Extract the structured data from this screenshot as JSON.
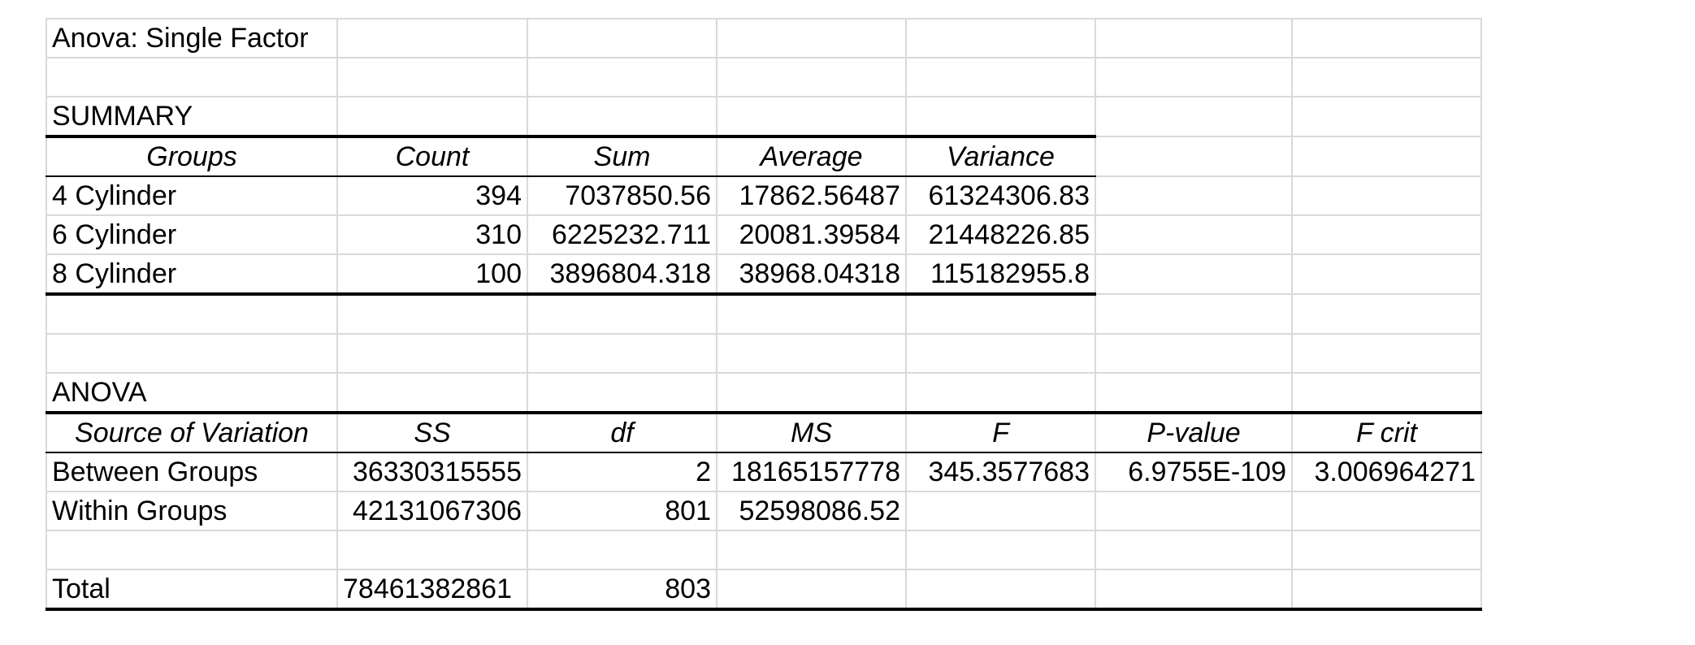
{
  "title": "Anova: Single Factor",
  "summary": {
    "label": "SUMMARY",
    "headers": [
      "Groups",
      "Count",
      "Sum",
      "Average",
      "Variance"
    ],
    "rows": [
      [
        "4 Cylinder",
        "394",
        "7037850.56",
        "17862.56487",
        "61324306.83"
      ],
      [
        "6 Cylinder",
        "310",
        "6225232.711",
        "20081.39584",
        "21448226.85"
      ],
      [
        "8 Cylinder",
        "100",
        "3896804.318",
        "38968.04318",
        "115182955.8"
      ]
    ]
  },
  "anova": {
    "label": "ANOVA",
    "headers": [
      "Source of Variation",
      "SS",
      "df",
      "MS",
      "F",
      "P-value",
      "F crit"
    ],
    "rows": [
      [
        "Between Groups",
        "36330315555",
        "2",
        "18165157778",
        "345.3577683",
        "6.9755E-109",
        "3.006964271"
      ],
      [
        "Within Groups",
        "42131067306",
        "801",
        "52598086.52",
        "",
        "",
        ""
      ]
    ],
    "total": [
      "Total",
      "78461382861",
      "803",
      "",
      "",
      "",
      ""
    ]
  }
}
